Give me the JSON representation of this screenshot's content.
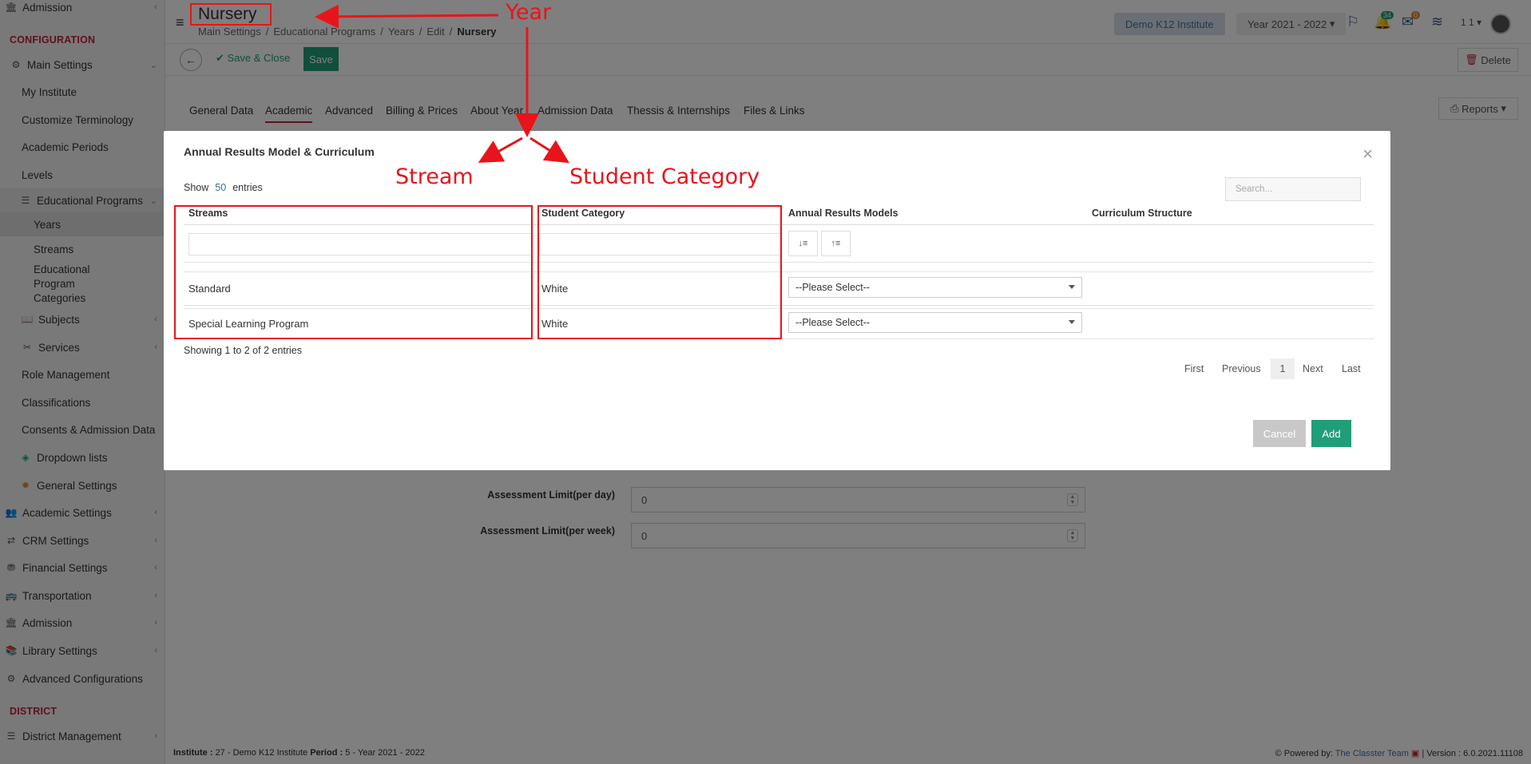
{
  "sidebar": {
    "top_item": "Admission",
    "config_section": "CONFIGURATION",
    "main_settings": "Main Settings",
    "items": [
      "My Institute",
      "Customize Terminology",
      "Academic Periods",
      "Levels"
    ],
    "educational_programs": "Educational Programs",
    "sub_items": [
      "Years",
      "Streams",
      "Educational Program Categories"
    ],
    "subjects": "Subjects",
    "services": "Services",
    "role_management": "Role Management",
    "classifications": "Classifications",
    "consents": "Consents & Admission Data",
    "dropdown_lists": "Dropdown lists",
    "general_settings": "General Settings",
    "academic_settings": "Academic Settings",
    "crm_settings": "CRM Settings",
    "financial_settings": "Financial Settings",
    "transportation": "Transportation",
    "admission": "Admission",
    "library_settings": "Library Settings",
    "advanced_configurations": "Advanced Configurations",
    "district_section": "DISTRICT",
    "district_management": "District Management"
  },
  "header": {
    "title": "Nursery",
    "breadcrumb": [
      "Main Settings",
      "Educational Programs",
      "Years",
      "Edit"
    ],
    "breadcrumb_current": "Nursery",
    "institute": "Demo K12 Institute",
    "year": "Year 2021 - 2022",
    "notif_count": "34",
    "mail_count": "0",
    "user_short": "1 1"
  },
  "toolbar": {
    "save_close": "Save & Close",
    "save": "Save",
    "delete": "Delete"
  },
  "tabs": [
    "General Data",
    "Academic",
    "Advanced",
    "Billing & Prices",
    "About Year",
    "Admission Data",
    "Thessis & Internships",
    "Files & Links"
  ],
  "reports": "Reports",
  "bg_form": {
    "limit_day_label": "Assessment Limit(per day)",
    "limit_day_value": "0",
    "limit_week_label": "Assessment Limit(per week)",
    "limit_week_value": "0"
  },
  "footer": {
    "institute_label": "Institute :",
    "institute_value": "27 - Demo K12 Institute",
    "period_label": "Period :",
    "period_value": "5 - Year 2021 - 2022",
    "powered_by": "Powered by:",
    "team": "The Classter Team",
    "version": "| Version : 6.0.2021.11108"
  },
  "modal": {
    "title": "Annual Results Model & Curriculum",
    "show": "Show",
    "entries_count": "50",
    "entries": "entries",
    "search_placeholder": "Search...",
    "columns": [
      "Streams",
      "Student Category",
      "Annual Results Models",
      "Curriculum Structure"
    ],
    "rows": [
      {
        "stream": "Standard",
        "category": "White",
        "model": "--Please Select--"
      },
      {
        "stream": "Special Learning Program",
        "category": "White",
        "model": "--Please Select--"
      }
    ],
    "showing": "Showing 1 to 2 of 2 entries",
    "pager": [
      "First",
      "Previous",
      "1",
      "Next",
      "Last"
    ],
    "cancel": "Cancel",
    "add": "Add"
  },
  "annotations": {
    "year": "Year",
    "stream": "Stream",
    "student_category": "Student Category"
  },
  "colors": {
    "accent_green": "#1f9e79",
    "brand_red": "#c0203a",
    "annotation_red": "#e8141b"
  }
}
